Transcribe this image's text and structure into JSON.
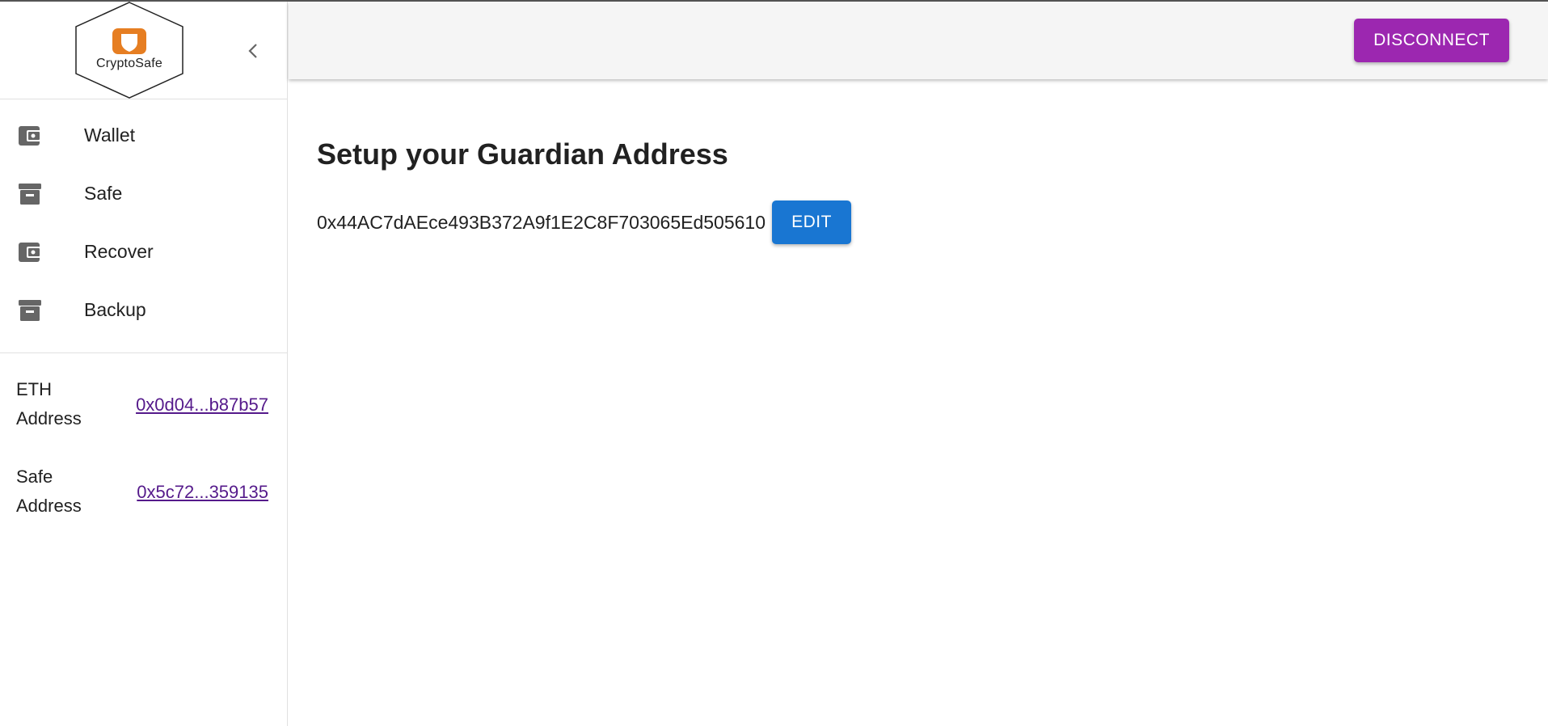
{
  "app": {
    "logo_text": "CryptoSafe"
  },
  "sidebar": {
    "items": [
      {
        "label": "Wallet",
        "icon": "wallet-icon"
      },
      {
        "label": "Safe",
        "icon": "archive-icon"
      },
      {
        "label": "Recover",
        "icon": "wallet-icon"
      },
      {
        "label": "Backup",
        "icon": "archive-icon"
      }
    ],
    "addresses": [
      {
        "title": "ETH Address",
        "value": "0x0d04...b87b57"
      },
      {
        "title": "Safe Address",
        "value": "0x5c72...359135"
      }
    ]
  },
  "header": {
    "disconnect_label": "DISCONNECT"
  },
  "main": {
    "title": "Setup your Guardian Address",
    "guardian_address": "0x44AC7dAEce493B372A9f1E2C8F703065Ed505610",
    "edit_label": "EDIT"
  },
  "colors": {
    "disconnect_button": "#9c27b0",
    "edit_button": "#1976d2",
    "logo_orange": "#e67e22",
    "link": "#551a8b"
  }
}
